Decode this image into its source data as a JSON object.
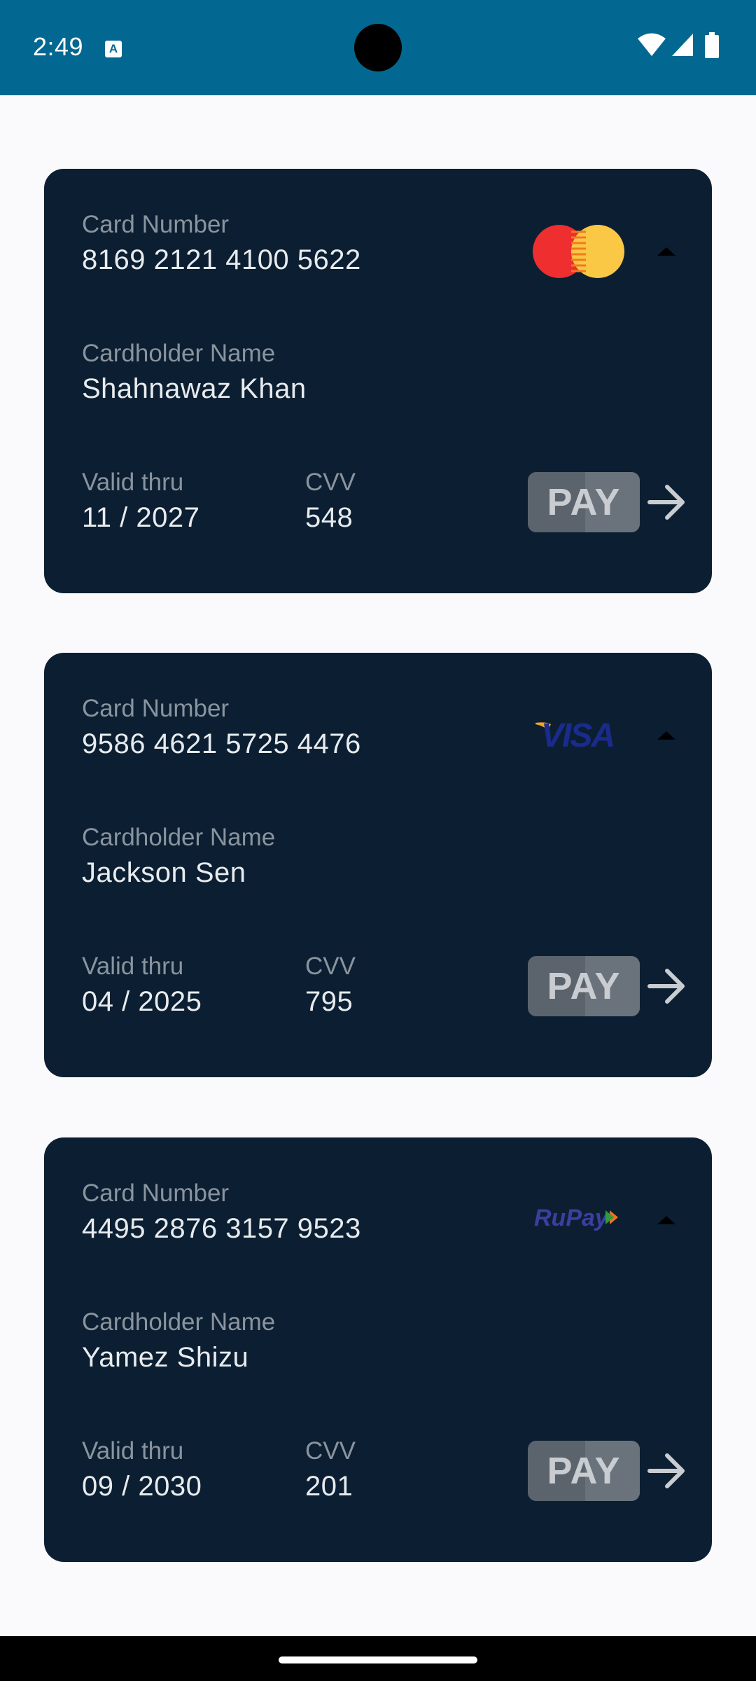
{
  "status_bar": {
    "time": "2:49",
    "notification_icon": "a-icon",
    "wifi_icon": "wifi-icon",
    "signal_icon": "signal-icon",
    "battery_icon": "battery-icon"
  },
  "labels": {
    "card_number": "Card Number",
    "cardholder_name": "Cardholder Name",
    "valid_thru": "Valid thru",
    "cvv": "CVV",
    "pay": "PAY"
  },
  "cards": [
    {
      "number": "8169 2121 4100 5622",
      "holder": "Shahnawaz Khan",
      "expiry": "11 / 2027",
      "cvv": "548",
      "brand": "mastercard-logo-icon"
    },
    {
      "number": "9586 4621 5725 4476",
      "holder": "Jackson Sen",
      "expiry": "04 / 2025",
      "cvv": "795",
      "brand": "visa-logo-icon"
    },
    {
      "number": "4495 2876 3157 9523",
      "holder": "Yamez Shizu",
      "expiry": "09 / 2030",
      "cvv": "201",
      "brand": "rupay-logo-icon"
    }
  ],
  "colors": {
    "status_bar": "#036891",
    "card_background": "#0c1f32",
    "page_background": "#fafafc",
    "pay_button": "#5b646d"
  }
}
